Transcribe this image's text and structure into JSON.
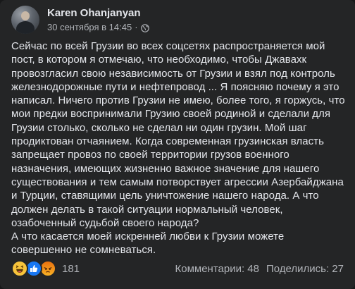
{
  "post": {
    "author": "Karen Ohanjanyan",
    "timestamp": "30 сентября в 14:45",
    "separator": "·",
    "privacy_icon": "globe-icon",
    "text": "Сейчас по всей Грузии во всех соцсетях распространяется мой пост, в котором я отмечаю, что необходимо, чтобы Джавахк провозгласил свою независимость от Грузии и взял под контроль железнодорожные пути и нефтепровод ... Я поясняю почему я это написал. Ничего против Грузии не имею, более того, я горжусь, что мои предки воспринимали Грузию своей родиной и сделали для Грузии столько, сколько не сделал ни один грузин. Мой шаг продиктован отчаянием. Когда современная грузинская власть запрещает провоз по своей территории грузов военного назначения, имеющих жизненно важное значение для нашего существования и тем самым потворствует агрессии Азербайджана и Турции, ставящими цель уничтожение нашего народа. А  что должен делать в такой ситуации нормальный человек,  озабоченный судьбой своего народа?\nА что касается моей искренней любви к Грузии можете совершенно не сомневаться."
  },
  "reactions": {
    "types": [
      "haha",
      "like",
      "angry"
    ],
    "count": "181"
  },
  "stats": {
    "comments": "Комментарии: 48",
    "shares": "Поделились: 27"
  },
  "colors": {
    "card_bg": "#242526",
    "text_primary": "#e4e6eb",
    "text_secondary": "#b0b3b8",
    "like_blue": "#1877f2"
  }
}
